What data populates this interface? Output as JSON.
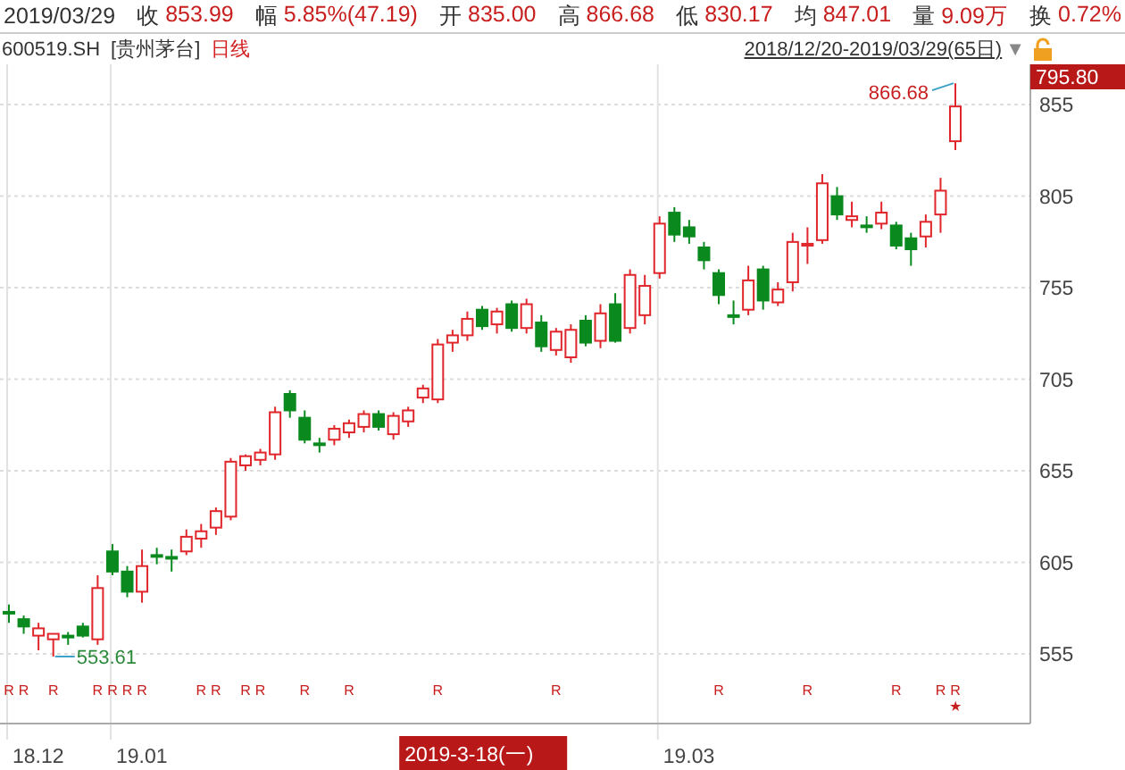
{
  "quote_bar": {
    "date": "2019/03/29",
    "fields": [
      {
        "label": "收",
        "value": "853.99"
      },
      {
        "label": "幅",
        "value": "5.85%(47.19)"
      },
      {
        "label": "开",
        "value": "835.00"
      },
      {
        "label": "高",
        "value": "866.68"
      },
      {
        "label": "低",
        "value": "830.17"
      },
      {
        "label": "均",
        "value": "847.01"
      },
      {
        "label": "量",
        "value": "9.09万"
      },
      {
        "label": "换",
        "value": "0.72%"
      }
    ]
  },
  "chart_header": {
    "symbol": "600519.SH",
    "name": "[贵州茅台]",
    "period": "日线",
    "range": "2018/12/20-2019/03/29(65日)",
    "dropdown": "▼"
  },
  "chart": {
    "cursor_price": "795.80",
    "cursor_date": "2019-3-18(一)",
    "x_axis_labels": [
      "18.12",
      "19.01",
      "19.03"
    ],
    "chart_data": {
      "type": "candlestick",
      "grid": true,
      "ylim": [
        517,
        877
      ],
      "yticks": [
        555,
        605,
        655,
        705,
        755,
        805,
        855
      ],
      "ohlc": [
        [
          578,
          582,
          572,
          578
        ],
        [
          574,
          576,
          566,
          570
        ],
        [
          565,
          572,
          557,
          569
        ],
        [
          563,
          566,
          553.61,
          566
        ],
        [
          565,
          567,
          560,
          564
        ],
        [
          570,
          572,
          564,
          565
        ],
        [
          563,
          598,
          560,
          591
        ],
        [
          611,
          615,
          598,
          600
        ],
        [
          600,
          603,
          586,
          589
        ],
        [
          589,
          612,
          583,
          603
        ],
        [
          609,
          613,
          604,
          609
        ],
        [
          608,
          612,
          600,
          608
        ],
        [
          611,
          623,
          609,
          619
        ],
        [
          618,
          626,
          613,
          622
        ],
        [
          624,
          635,
          620,
          633
        ],
        [
          630,
          662,
          628,
          660
        ],
        [
          658,
          664,
          655,
          663
        ],
        [
          661,
          667,
          658,
          665
        ],
        [
          664,
          690,
          661,
          687
        ],
        [
          697,
          699,
          684,
          688
        ],
        [
          684,
          688,
          670,
          672
        ],
        [
          670,
          673,
          665,
          670
        ],
        [
          672,
          680,
          669,
          678
        ],
        [
          676,
          683,
          673,
          681
        ],
        [
          679,
          688,
          676,
          686
        ],
        [
          686,
          688,
          677,
          679
        ],
        [
          675,
          687,
          672,
          685
        ],
        [
          682,
          690,
          679,
          688
        ],
        [
          695,
          702,
          692,
          700
        ],
        [
          694,
          727,
          692,
          724
        ],
        [
          725,
          732,
          720,
          729
        ],
        [
          729,
          742,
          726,
          738
        ],
        [
          743,
          745,
          732,
          734
        ],
        [
          735,
          744,
          730,
          742
        ],
        [
          746,
          748,
          731,
          733
        ],
        [
          733,
          749,
          730,
          746
        ],
        [
          736,
          740,
          720,
          723
        ],
        [
          721,
          733,
          718,
          731
        ],
        [
          717,
          735,
          714,
          732
        ],
        [
          737,
          740,
          723,
          725
        ],
        [
          726,
          746,
          722,
          741
        ],
        [
          746,
          752,
          725,
          726
        ],
        [
          733,
          765,
          730,
          762
        ],
        [
          740,
          762,
          735,
          756
        ],
        [
          763,
          794,
          760,
          790
        ],
        [
          796,
          799,
          780,
          784
        ],
        [
          788,
          792,
          779,
          783
        ],
        [
          777,
          780,
          765,
          770
        ],
        [
          763,
          765,
          746,
          751
        ],
        [
          740,
          748,
          735,
          740
        ],
        [
          743,
          767,
          740,
          759
        ],
        [
          765,
          767,
          743,
          748
        ],
        [
          747,
          758,
          745,
          754
        ],
        [
          758,
          785,
          753,
          780
        ],
        [
          778,
          788,
          768,
          779
        ],
        [
          781,
          817,
          779,
          812
        ],
        [
          805,
          810,
          792,
          795
        ],
        [
          792,
          802,
          788,
          794
        ],
        [
          789,
          794,
          785,
          789
        ],
        [
          790,
          802,
          787,
          796
        ],
        [
          789,
          791,
          776,
          778
        ],
        [
          782,
          785,
          767,
          776
        ],
        [
          783,
          795,
          777,
          791
        ],
        [
          795,
          815,
          785,
          808
        ],
        [
          835,
          866.68,
          830.17,
          853.99
        ]
      ],
      "annotations": [
        "866.68",
        "553.61",
        "R",
        "R",
        "R",
        "R",
        "R",
        "R",
        "R",
        "R",
        "R",
        "R",
        "R",
        "R",
        "R",
        "R",
        "R",
        "R",
        "R",
        "R",
        "R",
        "R",
        "★"
      ]
    }
  }
}
